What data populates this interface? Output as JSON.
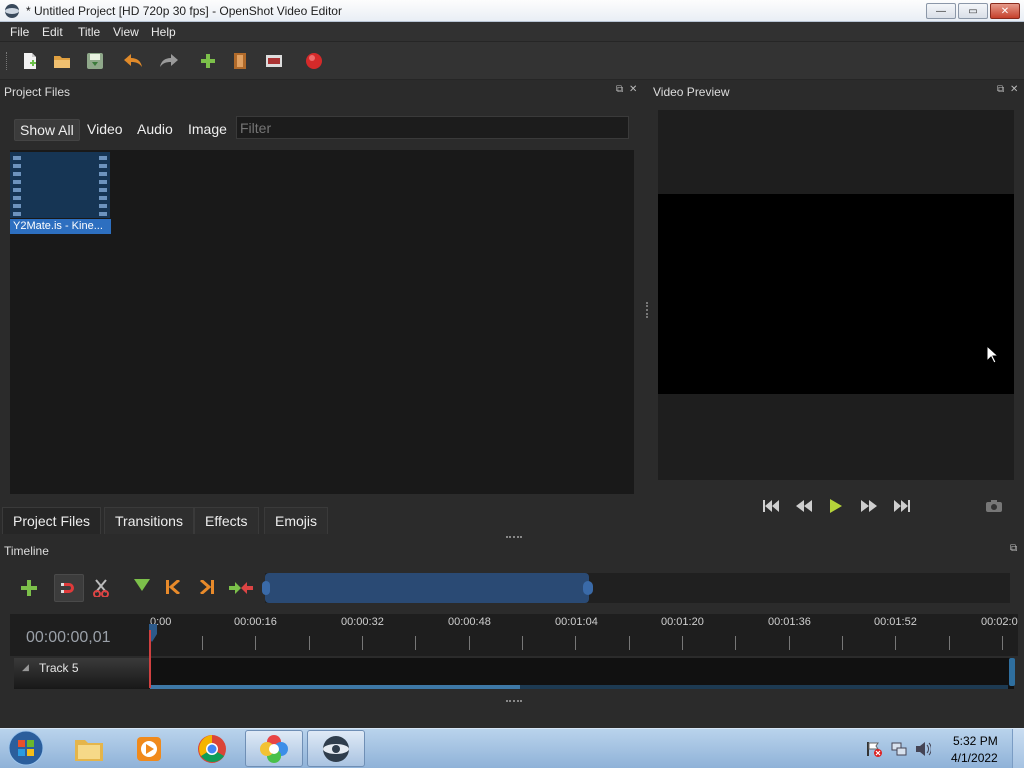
{
  "window": {
    "title": "* Untitled Project [HD 720p 30 fps] - OpenShot Video Editor",
    "controls": {
      "minimize": "—",
      "restore": "▭",
      "close": "✕"
    }
  },
  "menu": {
    "items": [
      {
        "label": "File"
      },
      {
        "label": "Edit"
      },
      {
        "label": "Title"
      },
      {
        "label": "View"
      },
      {
        "label": "Help"
      }
    ]
  },
  "toolbar": {
    "icons": [
      "new-project-icon",
      "open-project-icon",
      "save-project-icon",
      "undo-icon",
      "redo-icon",
      "import-files-icon",
      "profile-icon",
      "fullscreen-icon",
      "export-video-icon"
    ]
  },
  "project_files": {
    "title": "Project Files",
    "filters": [
      {
        "label": "Show All",
        "active": true
      },
      {
        "label": "Video",
        "active": false
      },
      {
        "label": "Audio",
        "active": false
      },
      {
        "label": "Image",
        "active": false
      }
    ],
    "filter_placeholder": "Filter",
    "files": [
      {
        "label": "Y2Mate.is - Kine...",
        "selected": true
      }
    ],
    "bottom_tabs": [
      {
        "label": "Project Files",
        "active": true
      },
      {
        "label": "Transitions",
        "active": false
      },
      {
        "label": "Effects",
        "active": false
      },
      {
        "label": "Emojis",
        "active": false
      }
    ]
  },
  "video_preview": {
    "title": "Video Preview",
    "controls": [
      "jump-start-icon",
      "rewind-icon",
      "play-icon",
      "fast-forward-icon",
      "jump-end-icon",
      "snapshot-icon"
    ]
  },
  "timeline": {
    "title": "Timeline",
    "toolbar_icons": [
      "add-track-icon",
      "snapping-icon",
      "razor-icon",
      "add-marker-icon",
      "previous-marker-icon",
      "next-marker-icon",
      "center-playhead-icon"
    ],
    "current_time": "00:00:00,01",
    "ticks": [
      "0:00",
      "00:00:16",
      "00:00:32",
      "00:00:48",
      "00:01:04",
      "00:01:20",
      "00:01:36",
      "00:01:52",
      "00:02:0"
    ],
    "tracks": [
      {
        "name": "Track 5"
      }
    ]
  },
  "taskbar": {
    "apps": [
      "windows-explorer",
      "media-player",
      "chrome",
      "photo-app",
      "openshot"
    ],
    "time": "5:32 PM",
    "date": "4/1/2022"
  },
  "colors": {
    "accent": "#2d6fc0",
    "playhead": "#d04040",
    "record": "#d42a2a"
  }
}
